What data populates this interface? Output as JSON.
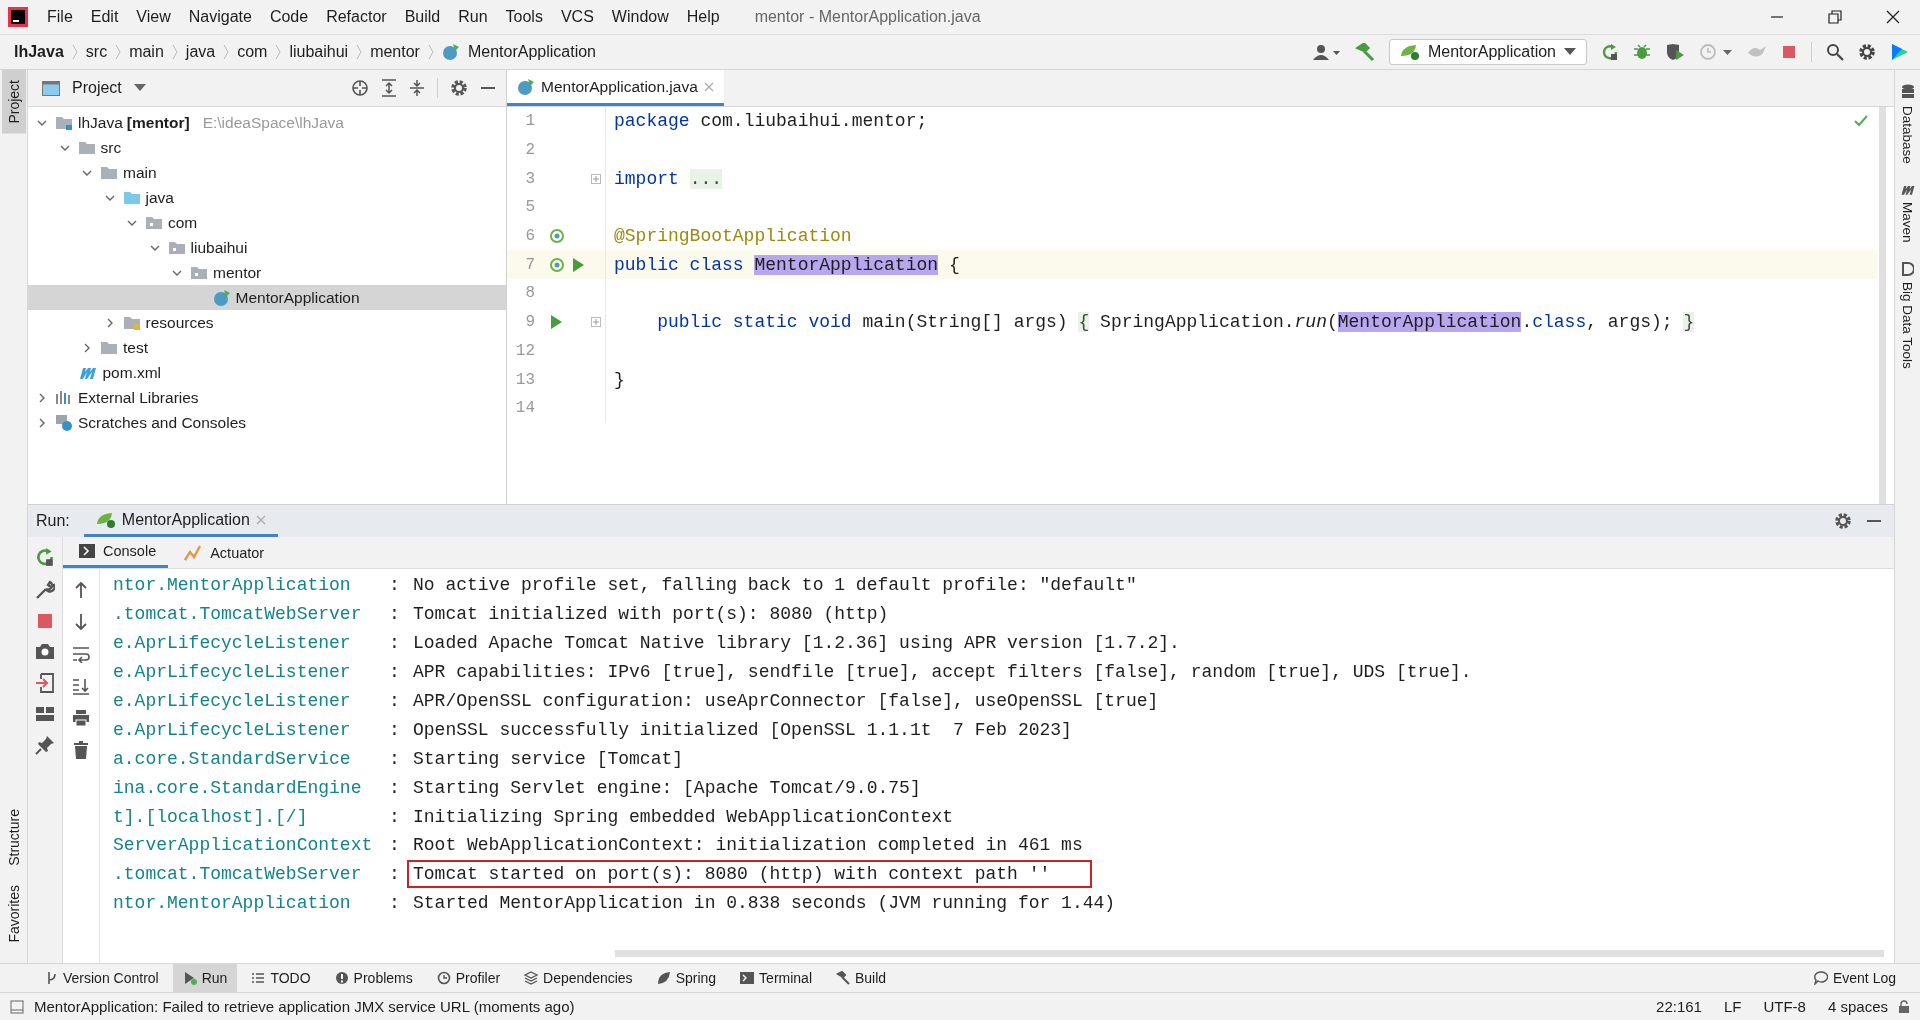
{
  "window": {
    "title": "mentor - MentorApplication.java"
  },
  "menu": [
    "File",
    "Edit",
    "View",
    "Navigate",
    "Code",
    "Refactor",
    "Build",
    "Run",
    "Tools",
    "VCS",
    "Window",
    "Help"
  ],
  "breadcrumb": [
    "lhJava",
    "src",
    "main",
    "java",
    "com",
    "liubaihui",
    "mentor",
    "MentorApplication"
  ],
  "run_configuration": "MentorApplication",
  "left_strip": [
    {
      "label": "Project",
      "selected": true
    },
    {
      "label": "Structure",
      "selected": false
    },
    {
      "label": "Favorites",
      "selected": false
    }
  ],
  "right_strip": [
    "Database",
    "Maven",
    "Big Data Tools"
  ],
  "project": {
    "title": "Project",
    "tree": [
      {
        "label": "lhJava",
        "qualifier": "[mentor]",
        "path": "E:\\ideaSpace\\lhJava",
        "kind": "module",
        "expanded": true,
        "selected": false,
        "children": [
          {
            "label": "src",
            "kind": "folder",
            "expanded": true,
            "selected": false,
            "children": [
              {
                "label": "main",
                "kind": "folder",
                "expanded": true,
                "selected": false,
                "children": [
                  {
                    "label": "java",
                    "kind": "source",
                    "expanded": true,
                    "selected": false,
                    "children": [
                      {
                        "label": "com",
                        "kind": "package",
                        "expanded": true,
                        "selected": false,
                        "children": [
                          {
                            "label": "liubaihui",
                            "kind": "package",
                            "expanded": true,
                            "selected": false,
                            "children": [
                              {
                                "label": "mentor",
                                "kind": "package",
                                "expanded": true,
                                "selected": false,
                                "children": [
                                  {
                                    "label": "MentorApplication",
                                    "kind": "class",
                                    "selected": true
                                  }
                                ]
                              }
                            ]
                          }
                        ]
                      }
                    ]
                  },
                  {
                    "label": "resources",
                    "kind": "resources",
                    "expanded": false,
                    "selected": false
                  }
                ]
              },
              {
                "label": "test",
                "kind": "folder",
                "expanded": false,
                "selected": false
              }
            ]
          },
          {
            "label": "pom.xml",
            "kind": "maven",
            "selected": false
          }
        ]
      },
      {
        "label": "External Libraries",
        "kind": "libraries",
        "expanded": false,
        "selected": false
      },
      {
        "label": "Scratches and Consoles",
        "kind": "scratches",
        "expanded": false,
        "selected": false
      }
    ]
  },
  "editor": {
    "tabs": [
      {
        "label": "MentorApplication.java",
        "selected": true
      }
    ],
    "lines": [
      {
        "number": "1",
        "bean": false,
        "runnable": false,
        "foldable": false,
        "current": false,
        "tokens": [
          {
            "kind": "keyword",
            "text": "package"
          },
          {
            "kind": "plain",
            "text": " com.liubaihui.mentor;"
          }
        ]
      },
      {
        "number": "2",
        "bean": false,
        "runnable": false,
        "foldable": false,
        "current": false
      },
      {
        "number": "3",
        "bean": false,
        "runnable": false,
        "foldable": true,
        "current": false,
        "tokens": [
          {
            "kind": "keyword",
            "text": "import "
          },
          {
            "kind": "fold",
            "text": "..."
          }
        ]
      },
      {
        "number": "5",
        "bean": false,
        "runnable": false,
        "foldable": false,
        "current": false
      },
      {
        "number": "6",
        "bean": true,
        "runnable": false,
        "foldable": false,
        "current": false,
        "tokens": [
          {
            "kind": "annotation",
            "text": "@SpringBootApplication"
          }
        ]
      },
      {
        "number": "7",
        "bean": true,
        "runnable": true,
        "foldable": false,
        "current": true,
        "tokens": [
          {
            "kind": "keyword",
            "text": "public class "
          },
          {
            "kind": "match",
            "text": "MentorApplication"
          },
          {
            "kind": "plain",
            "text": " {"
          }
        ]
      },
      {
        "number": "8",
        "bean": false,
        "runnable": false,
        "foldable": false,
        "current": false
      },
      {
        "number": "9",
        "bean": false,
        "runnable": true,
        "foldable": true,
        "current": false,
        "tokens": [
          {
            "kind": "keyword",
            "text": "    public static void"
          },
          {
            "kind": "plain",
            "text": " main(String[] args) "
          },
          {
            "kind": "fold",
            "text": "{"
          },
          {
            "kind": "plain",
            "text": " SpringApplication."
          },
          {
            "kind": "italic",
            "text": "run"
          },
          {
            "kind": "plain",
            "text": "("
          },
          {
            "kind": "match",
            "text": "MentorApplication"
          },
          {
            "kind": "plain",
            "text": "."
          },
          {
            "kind": "keyword",
            "text": "class"
          },
          {
            "kind": "plain",
            "text": ", args); "
          },
          {
            "kind": "fold",
            "text": "}"
          }
        ]
      },
      {
        "number": "12",
        "bean": false,
        "runnable": false,
        "foldable": false,
        "current": false
      },
      {
        "number": "13",
        "bean": false,
        "runnable": false,
        "foldable": false,
        "current": false,
        "tokens": [
          {
            "kind": "plain",
            "text": "}"
          }
        ]
      },
      {
        "number": "14",
        "bean": false,
        "runnable": false,
        "foldable": false,
        "current": false
      }
    ]
  },
  "run": {
    "title": "Run:",
    "tabs": [
      {
        "label": "MentorApplication",
        "selected": true
      }
    ],
    "subtabs": [
      {
        "label": "Console",
        "selected": true
      },
      {
        "label": "Actuator",
        "selected": false
      }
    ],
    "log": [
      {
        "logger": "ntor.MentorApplication",
        "separator": ":",
        "message": "No active profile set, falling back to 1 default profile: \"default\"",
        "boxed": false
      },
      {
        "logger": ".tomcat.TomcatWebServer",
        "separator": ":",
        "message": "Tomcat initialized with port(s): 8080 (http)",
        "boxed": false
      },
      {
        "logger": "e.AprLifecycleListener",
        "separator": ":",
        "message": "Loaded Apache Tomcat Native library [1.2.36] using APR version [1.7.2].",
        "boxed": false
      },
      {
        "logger": "e.AprLifecycleListener",
        "separator": ":",
        "message": "APR capabilities: IPv6 [true], sendfile [true], accept filters [false], random [true], UDS [true].",
        "boxed": false
      },
      {
        "logger": "e.AprLifecycleListener",
        "separator": ":",
        "message": "APR/OpenSSL configuration: useAprConnector [false], useOpenSSL [true]",
        "boxed": false
      },
      {
        "logger": "e.AprLifecycleListener",
        "separator": ":",
        "message": "OpenSSL successfully initialized [OpenSSL 1.1.1t  7 Feb 2023]",
        "boxed": false
      },
      {
        "logger": "a.core.StandardService",
        "separator": ":",
        "message": "Starting service [Tomcat]",
        "boxed": false
      },
      {
        "logger": "ina.core.StandardEngine",
        "separator": ":",
        "message": "Starting Servlet engine: [Apache Tomcat/9.0.75]",
        "boxed": false
      },
      {
        "logger": "t].[localhost].[/]",
        "separator": ":",
        "message": "Initializing Spring embedded WebApplicationContext",
        "boxed": false
      },
      {
        "logger": "ServerApplicationContext",
        "separator": ":",
        "message": "Root WebApplicationContext: initialization completed in 461 ms",
        "boxed": false
      },
      {
        "logger": ".tomcat.TomcatWebServer",
        "separator": ":",
        "message": "Tomcat started on port(s): 8080 (http) with context path ''",
        "boxed": true
      },
      {
        "logger": "ntor.MentorApplication",
        "separator": ":",
        "message": "Started MentorApplication in 0.838 seconds (JVM running for 1.44)",
        "boxed": false
      }
    ]
  },
  "tool_windows": [
    {
      "label": "Version Control",
      "kind": "vcs",
      "selected": false
    },
    {
      "label": "Run",
      "kind": "run",
      "selected": true
    },
    {
      "label": "TODO",
      "kind": "todo",
      "selected": false
    },
    {
      "label": "Problems",
      "kind": "problems",
      "selected": false
    },
    {
      "label": "Profiler",
      "kind": "profiler",
      "selected": false
    },
    {
      "label": "Dependencies",
      "kind": "dependencies",
      "selected": false
    },
    {
      "label": "Spring",
      "kind": "spring",
      "selected": false
    },
    {
      "label": "Terminal",
      "kind": "terminal",
      "selected": false
    },
    {
      "label": "Build",
      "kind": "build",
      "selected": false
    }
  ],
  "event_log": "Event Log",
  "status_bar": {
    "message": "MentorApplication: Failed to retrieve application JMX service URL (moments ago)",
    "items": [
      "22:161",
      "LF",
      "UTF-8",
      "4 spaces"
    ]
  }
}
